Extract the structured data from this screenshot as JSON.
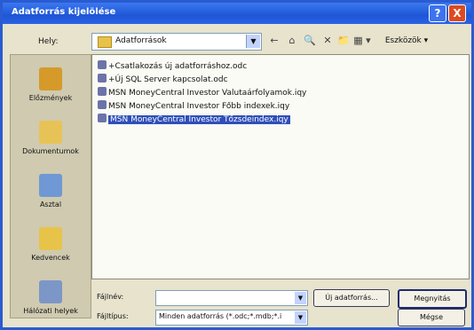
{
  "window": {
    "title": "Adatforrás kijelölése",
    "help": "?",
    "close": "X"
  },
  "toolbar": {
    "look_in_label": "Hely:",
    "folder": "Adatforrások",
    "dropdown": "▼",
    "back": "←",
    "up": "⌂",
    "search": "🔍",
    "delete": "✕",
    "new_folder": "📁",
    "views": "▦ ▾",
    "tools": "Eszközök ▾"
  },
  "places": [
    {
      "label": "Előzmények",
      "icon": "history-icon",
      "color": "#d69a2b"
    },
    {
      "label": "Dokumentumok",
      "icon": "documents-icon",
      "color": "#e7c357"
    },
    {
      "label": "Asztal",
      "icon": "desktop-icon",
      "color": "#6f98d4"
    },
    {
      "label": "Kedvencek",
      "icon": "favorites-icon",
      "color": "#e8c34a"
    },
    {
      "label": "Hálózati helyek",
      "icon": "network-icon",
      "color": "#7c96c8"
    }
  ],
  "files": [
    {
      "name": "+Csatlakozás új adatforráshoz.odc",
      "selected": false
    },
    {
      "name": "+Új SQL Server kapcsolat.odc",
      "selected": false
    },
    {
      "name": "MSN MoneyCentral Investor Valutaárfolyamok.iqy",
      "selected": false
    },
    {
      "name": "MSN MoneyCentral Investor Főbb indexek.iqy",
      "selected": false
    },
    {
      "name": "MSN MoneyCentral Investor Tőzsdeindex.iqy",
      "selected": true
    }
  ],
  "footer": {
    "filename_label": "Fájlnév:",
    "filename_value": "",
    "filetype_label": "Fájltípus:",
    "filetype_value": "Minden adatforrás (*.odc;*.mdb;*.i",
    "new_source_button": "Új adatforrás...",
    "open_button": "Megnyitás",
    "cancel_button": "Mégse"
  }
}
